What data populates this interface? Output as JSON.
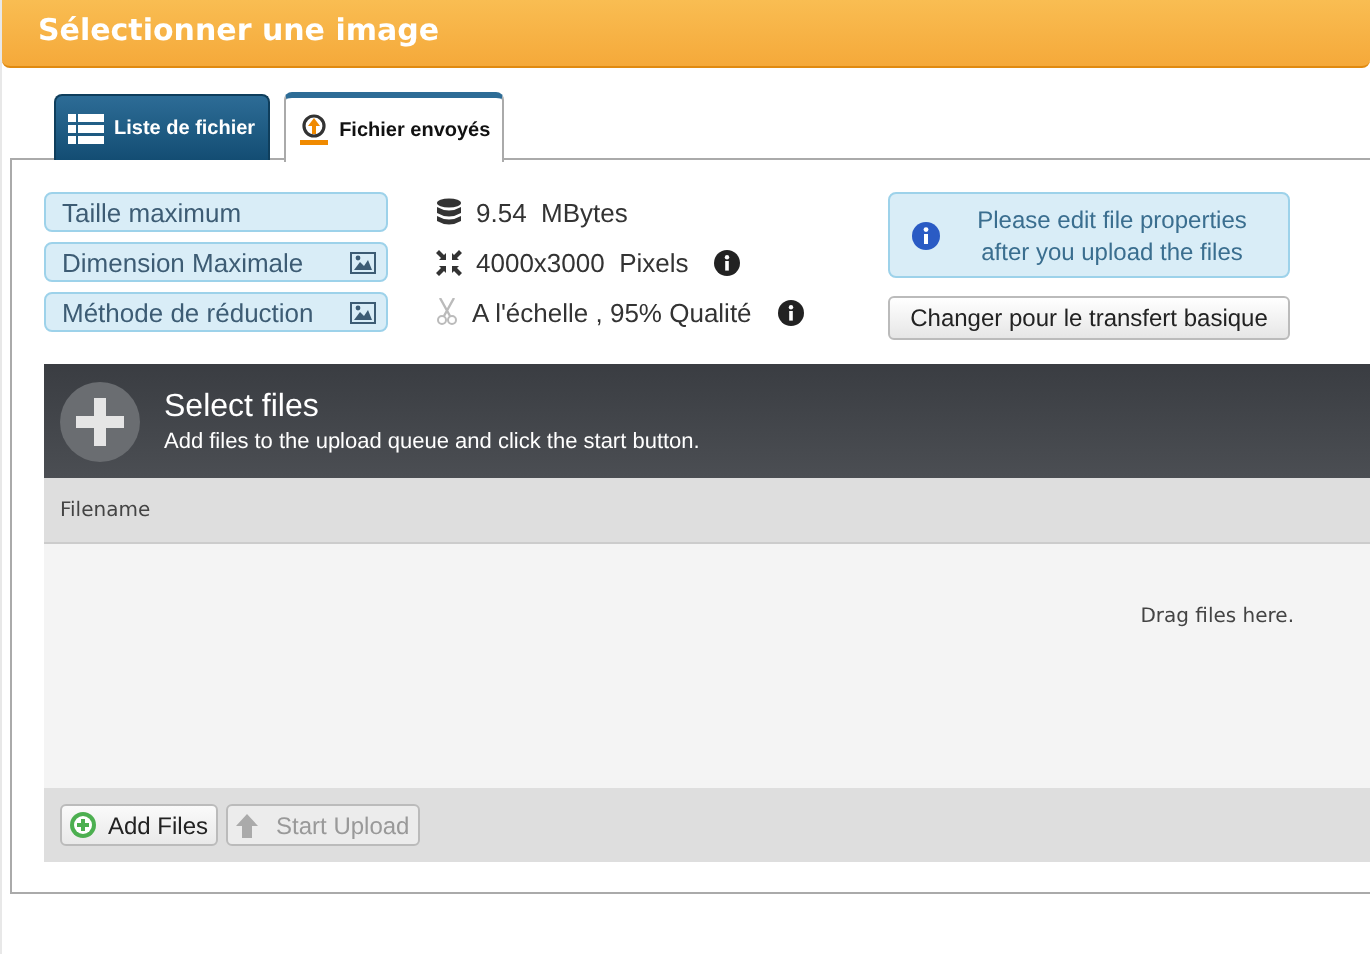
{
  "header": {
    "title": "Sélectionner une image"
  },
  "tabs": [
    {
      "label": "Liste de fichier",
      "selected": false
    },
    {
      "label": "Fichier envoyés",
      "selected": true
    }
  ],
  "properties": [
    {
      "label": "Taille maximum",
      "value": "9.54  MBytes"
    },
    {
      "label": "Dimension Maximale",
      "value": "4000x3000  Pixels"
    },
    {
      "label": "Méthode de réduction",
      "value": "A l'échelle , 95% Qualité"
    }
  ],
  "notice": "Please edit file properties after you upload the files",
  "switch_button": "Changer pour le transfert basique",
  "uploader": {
    "title": "Select files",
    "subtitle": "Add files to the upload queue and click the start button.",
    "column": "Filename",
    "drop_hint": "Drag files here.",
    "buttons": [
      {
        "label": "Add Files",
        "disabled": false
      },
      {
        "label": "Start Upload",
        "disabled": true
      }
    ]
  }
}
